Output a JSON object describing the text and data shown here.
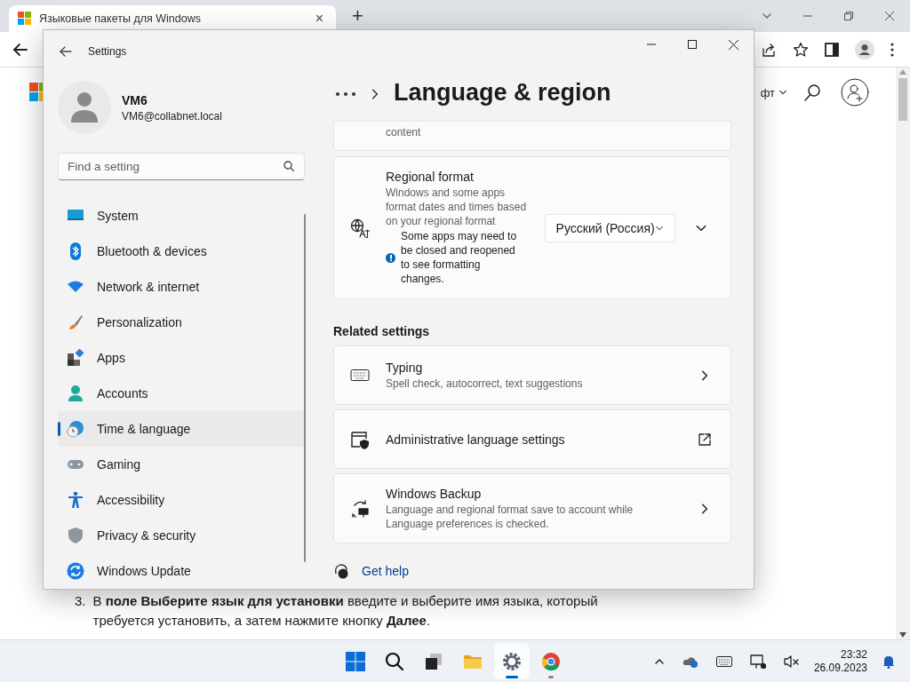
{
  "browser": {
    "tab": {
      "title": "Языковые пакеты для Windows",
      "close": "×"
    },
    "new_tab": "+",
    "page": {
      "header_link": "фт",
      "instruction": {
        "number": "3.",
        "text": "В **поле Выберите язык для установки** введите и выберите имя языка, который требуется установить, а затем нажмите кнопку **Далее**."
      }
    }
  },
  "settings": {
    "window": {
      "title": "Settings"
    },
    "profile": {
      "name": "VM6",
      "email": "VM6@collabnet.local"
    },
    "search": {
      "placeholder": "Find a setting"
    },
    "nav": {
      "items": [
        {
          "label": "System",
          "selected": false
        },
        {
          "label": "Bluetooth & devices",
          "selected": false
        },
        {
          "label": "Network & internet",
          "selected": false
        },
        {
          "label": "Personalization",
          "selected": false
        },
        {
          "label": "Apps",
          "selected": false
        },
        {
          "label": "Accounts",
          "selected": false
        },
        {
          "label": "Time & language",
          "selected": true
        },
        {
          "label": "Gaming",
          "selected": false
        },
        {
          "label": "Accessibility",
          "selected": false
        },
        {
          "label": "Privacy & security",
          "selected": false
        },
        {
          "label": "Windows Update",
          "selected": false
        }
      ]
    },
    "page_title": "Language & region",
    "partial_card": {
      "description": "content"
    },
    "regional_format": {
      "title": "Regional format",
      "description": "Windows and some apps format dates and times based on your regional format",
      "note": "Some apps may need to be closed and reopened to see formatting changes.",
      "dropdown": {
        "value": "Русский (Россия)"
      },
      "expanded": false
    },
    "related_settings": {
      "heading": "Related settings",
      "items": [
        {
          "kind": "navigate",
          "title": "Typing",
          "description": "Spell check, autocorrect, text suggestions"
        },
        {
          "kind": "external",
          "title": "Administrative language settings"
        },
        {
          "kind": "navigate",
          "title": "Windows Backup",
          "description": "Language and regional format save to account while Language preferences is checked."
        }
      ]
    },
    "get_help": "Get help"
  },
  "taskbar": {
    "apps": [
      {
        "selected": false,
        "running": false
      },
      {
        "selected": false,
        "running": false
      },
      {
        "selected": false,
        "running": false
      },
      {
        "selected": false,
        "running": false
      },
      {
        "selected": true,
        "running": true
      },
      {
        "selected": false,
        "running": true
      }
    ],
    "clock": {
      "time": "23:32",
      "date": "26.09.2023"
    }
  }
}
